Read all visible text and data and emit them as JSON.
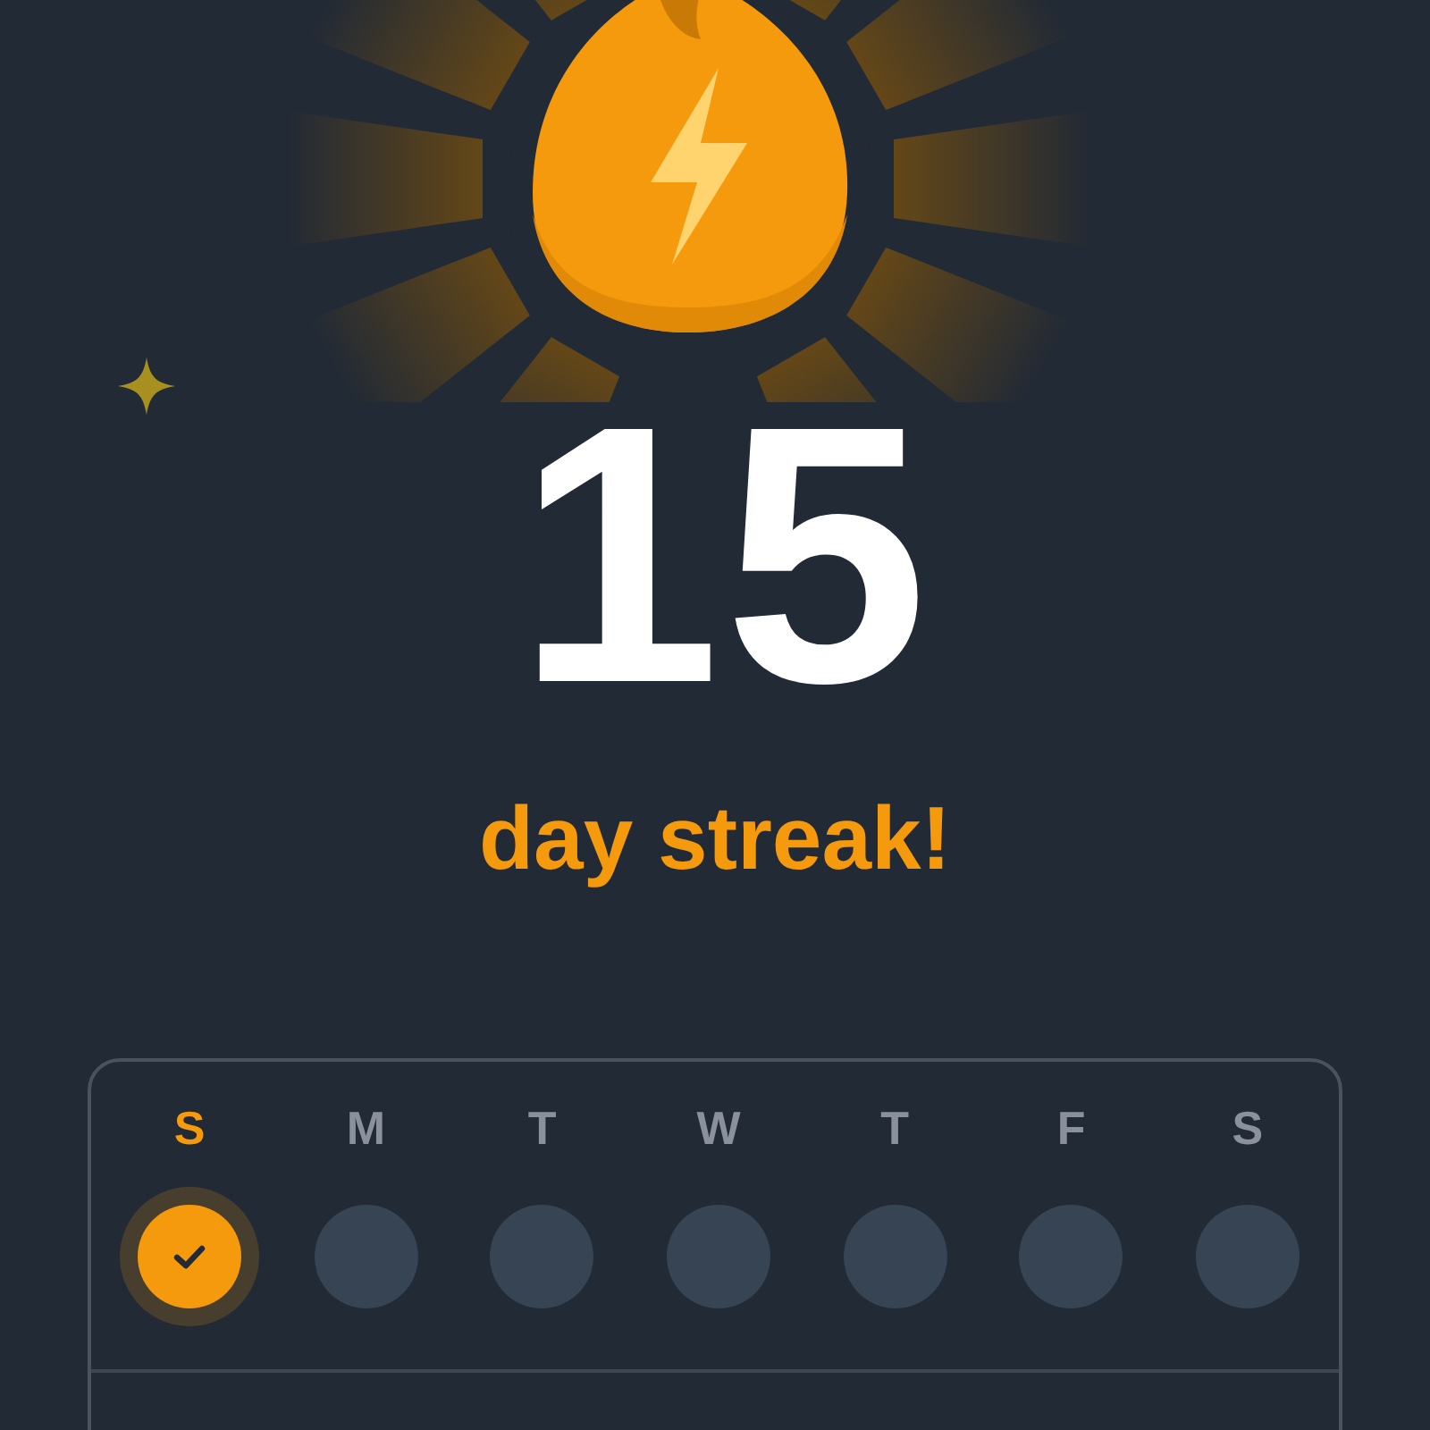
{
  "streak": {
    "count": "15",
    "label": "day streak!"
  },
  "days": [
    {
      "label": "S",
      "selected": true,
      "checked": true
    },
    {
      "label": "M",
      "selected": false,
      "checked": false
    },
    {
      "label": "T",
      "selected": false,
      "checked": false
    },
    {
      "label": "W",
      "selected": false,
      "checked": false
    },
    {
      "label": "T",
      "selected": false,
      "checked": false
    },
    {
      "label": "F",
      "selected": false,
      "checked": false
    },
    {
      "label": "S",
      "selected": false,
      "checked": false
    }
  ]
}
